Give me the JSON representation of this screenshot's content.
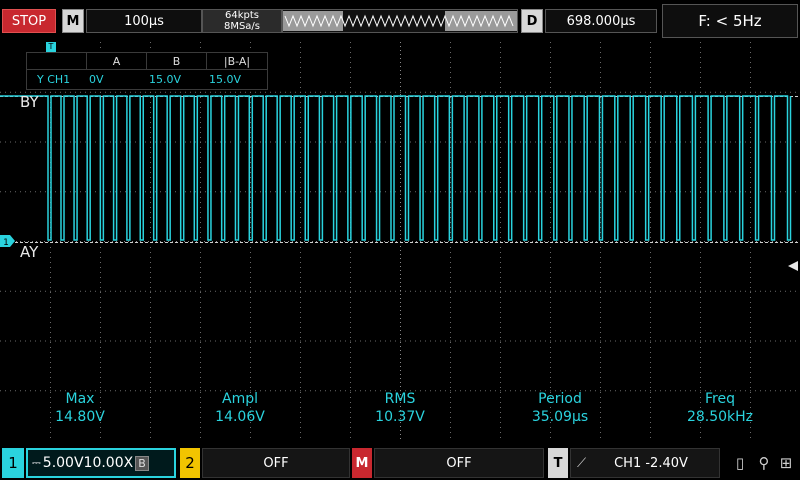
{
  "topbar": {
    "run_state": "STOP",
    "menu_key": "M",
    "timebase": "100µs",
    "memory_depth": "64kpts",
    "sample_rate": "8MSa/s",
    "delay_key": "D",
    "delay": "698.000µs",
    "trigger_freq": "F: < 5Hz"
  },
  "cursor_table": {
    "marker": "T",
    "headers": [
      "",
      "A",
      "B",
      "|B-A|"
    ],
    "row": [
      "Y CH1",
      "0V",
      "15.0V",
      "15.0V"
    ]
  },
  "cursor_labels": {
    "b": "BY",
    "a": "AY"
  },
  "channel_marker": "1",
  "measurements": [
    {
      "name": "Max",
      "value": "14.80V"
    },
    {
      "name": "Ampl",
      "value": "14.06V"
    },
    {
      "name": "RMS",
      "value": "10.37V"
    },
    {
      "name": "Period",
      "value": "35.09µs"
    },
    {
      "name": "Freq",
      "value": "28.50kHz"
    }
  ],
  "bottombar": {
    "ch1_num": "1",
    "ch1_text": "5.00V10.00X",
    "ch1_bw": "B",
    "ch2_num": "2",
    "ch2_state": "OFF",
    "math_key": "M",
    "math_state": "OFF",
    "trig_key": "T",
    "trig_text": "CH1 -2.40V"
  },
  "colors": {
    "trace": "#2ad3de",
    "stop": "#c8282f",
    "ch2": "#f2c400"
  }
}
